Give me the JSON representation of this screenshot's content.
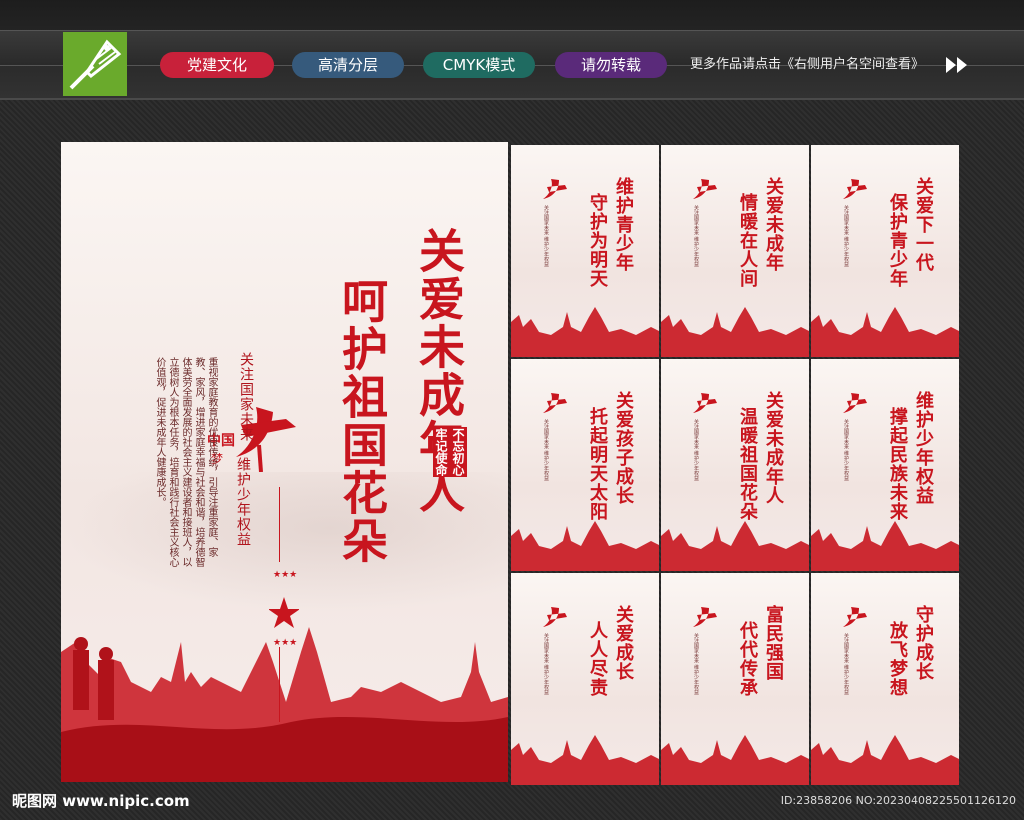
{
  "header": {
    "tags": [
      "党建文化",
      "高清分层",
      "CMYK模式",
      "请勿转载"
    ],
    "more_text": "更多作品请点击《右侧用户名空间查看》"
  },
  "main_poster": {
    "title_right": "关爱未成年人",
    "title_left": "呵护祖国花朵",
    "subtitle_1": "关注国家未来",
    "subtitle_2": "维护少年权益",
    "paragraph": "重视家庭教育的优良传统，引导注重家庭、家教、家风，增进家庭幸福与社会和谐，培养德智体美劳全面发展的社会主义建设者和接班人，以立德树人为根本任务，培育和践行社会主义核心价值观，促进未成年人健康成长。",
    "stamp_1": "不忘初心",
    "stamp_2": "牢记使命",
    "logo_text": "中国梦"
  },
  "small_posters": [
    {
      "line1": "维护青少年",
      "line2": "守护为明天"
    },
    {
      "line1": "关爱未成年",
      "line2": "情暖在人间"
    },
    {
      "line1": "关爱下一代",
      "line2": "保护青少年"
    },
    {
      "line1": "关爱孩子成长",
      "line2": "托起明天太阳"
    },
    {
      "line1": "关爱未成年人",
      "line2": "温暖祖国花朵"
    },
    {
      "line1": "维护少年权益",
      "line2": "撑起民族未来"
    },
    {
      "line1": "关爱成长",
      "line2": "人人尽责"
    },
    {
      "line1": "富民强国",
      "line2": "代代传承"
    },
    {
      "line1": "守护成长",
      "line2": "放飞梦想"
    }
  ],
  "small_poster_text": "关注国家未来 维护少年权益",
  "footer": {
    "site": "昵图网 www.nipic.com",
    "id": "ID:23858206 NO:20230408225501126120"
  },
  "colors": {
    "accent_red": "#c8151e",
    "logo_green": "#6aaa2c"
  }
}
